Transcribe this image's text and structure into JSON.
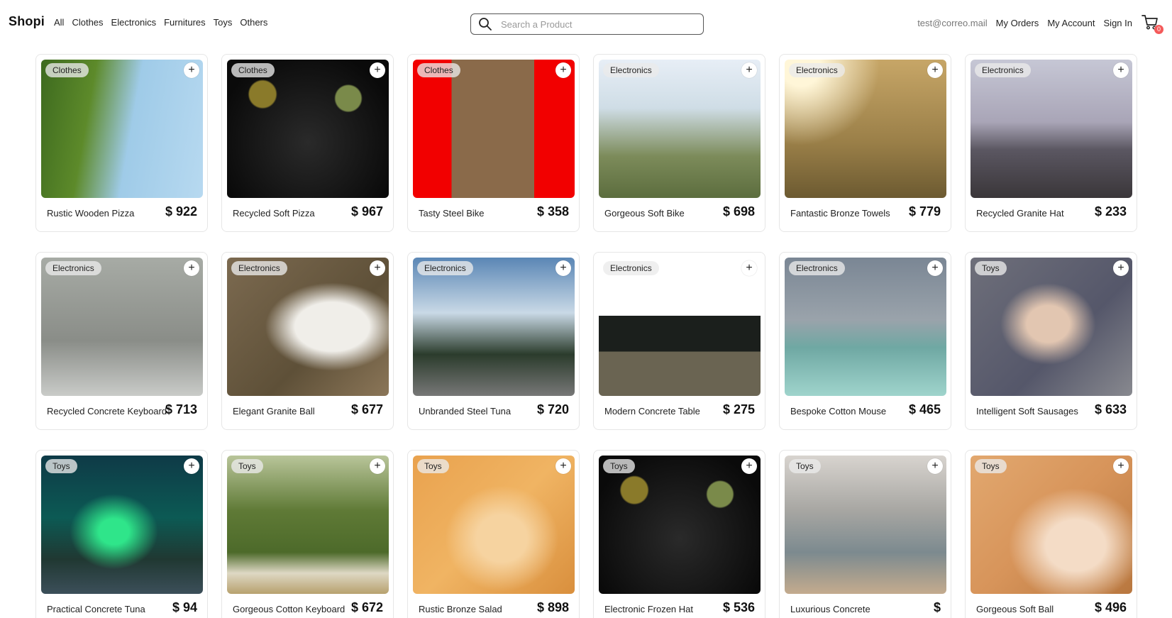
{
  "navbar": {
    "brand": "Shopi",
    "categories": [
      "All",
      "Clothes",
      "Electronics",
      "Furnitures",
      "Toys",
      "Others"
    ],
    "search_placeholder": "Search a Product",
    "email": "test@correo.mail",
    "my_orders": "My Orders",
    "my_account": "My Account",
    "sign_in": "Sign In",
    "cart_count": "0"
  },
  "products": [
    {
      "category": "Clothes",
      "name": "Rustic Wooden Pizza",
      "price": "$ 922",
      "image": "orange-tree"
    },
    {
      "category": "Clothes",
      "name": "Recycled Soft Pizza",
      "price": "$ 967",
      "image": "black-cat"
    },
    {
      "category": "Clothes",
      "name": "Tasty Steel Bike",
      "price": "$ 358",
      "image": "cat-on-floor"
    },
    {
      "category": "Electronics",
      "name": "Gorgeous Soft Bike",
      "price": "$ 698",
      "image": "fluffy-cat"
    },
    {
      "category": "Electronics",
      "name": "Fantastic Bronze Towels",
      "price": "$ 779",
      "image": "sunny-grass"
    },
    {
      "category": "Electronics",
      "name": "Recycled Granite Hat",
      "price": "$ 233",
      "image": "mountains"
    },
    {
      "category": "Electronics",
      "name": "Recycled Concrete Keyboard",
      "price": "$ 713",
      "image": "man-walking"
    },
    {
      "category": "Electronics",
      "name": "Elegant Granite Ball",
      "price": "$ 677",
      "image": "calico-cat"
    },
    {
      "category": "Electronics",
      "name": "Unbranded Steel Tuna",
      "price": "$ 720",
      "image": "valley-road"
    },
    {
      "category": "Electronics",
      "name": "Modern Concrete Table",
      "price": "$ 275",
      "image": "forest"
    },
    {
      "category": "Electronics",
      "name": "Bespoke Cotton Mouse",
      "price": "$ 465",
      "image": "sea-cliffs"
    },
    {
      "category": "Toys",
      "name": "Intelligent Soft Sausages",
      "price": "$ 633",
      "image": "hand-on-glass"
    },
    {
      "category": "Toys",
      "name": "Practical Concrete Tuna",
      "price": "$ 94",
      "image": "aurora"
    },
    {
      "category": "Toys",
      "name": "Gorgeous Cotton Keyboard",
      "price": "$ 672",
      "image": "sheep-field"
    },
    {
      "category": "Toys",
      "name": "Rustic Bronze Salad",
      "price": "$ 898",
      "image": "ginger-kitten"
    },
    {
      "category": "Toys",
      "name": "Electronic Frozen Hat",
      "price": "$ 536",
      "image": "black-cat"
    },
    {
      "category": "Toys",
      "name": "Luxurious Concrete",
      "price": "$",
      "image": "street-scene"
    },
    {
      "category": "Toys",
      "name": "Gorgeous Soft Ball",
      "price": "$ 496",
      "image": "ginger-cat"
    }
  ]
}
